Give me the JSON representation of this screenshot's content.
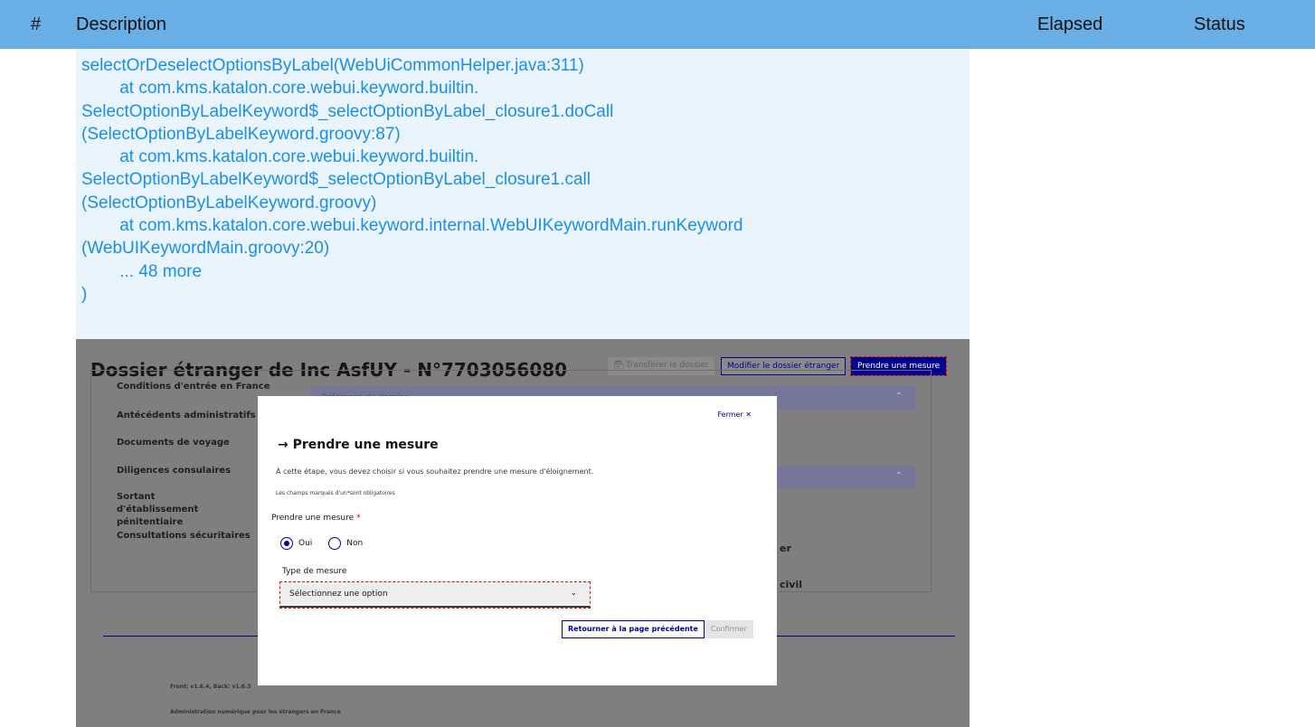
{
  "header": {
    "hash": "#",
    "description": "Description",
    "elapsed": "Elapsed",
    "status": "Status"
  },
  "log_lines": [
    "selectOrDeselectOptionsByLabel(WebUiCommonHelper.java:311)",
    "\tat com.kms.katalon.core.webui.keyword.builtin.",
    "SelectOptionByLabelKeyword$_selectOptionByLabel_closure1.doCall",
    "(SelectOptionByLabelKeyword.groovy:87)",
    "\tat com.kms.katalon.core.webui.keyword.builtin.",
    "SelectOptionByLabelKeyword$_selectOptionByLabel_closure1.call",
    "(SelectOptionByLabelKeyword.groovy)",
    "\tat com.kms.katalon.core.webui.keyword.internal.WebUIKeywordMain.runKeyword",
    "(WebUIKeywordMain.groovy:20)",
    "\t... 48 more",
    ")"
  ],
  "screenshot": {
    "page_title": "Dossier étranger de Inc AsfUY - N°7703056080",
    "toolbar": {
      "transfer": "Transférer le dossier",
      "modify": "Modifier le dossier étranger",
      "take_measure": "Prendre une mesure"
    },
    "sidenav": [
      "Conditions d'entrée en France",
      "Antécédents administratifs",
      "Documents de voyage",
      "Diligences consulaires",
      "Sortant d'établissement pénitentiaire",
      "Consultations sécuritaires"
    ],
    "section_ref": "Référence du dossier",
    "partial_right": [
      "er",
      "civil"
    ],
    "footer_version": "Front: v1.6.4, Back: v1.6.3",
    "footer_tagline": "Administration numérique pour les étrangers en France",
    "modal": {
      "close": "Fermer",
      "title": "Prendre une mesure",
      "description": "À cette étape, vous devez choisir si vous souhaitez prendre une mesure d'éloignement.",
      "required_note_pre": "Les champs marqués d'un",
      "required_note_post": "sont obligatoires",
      "field_label": "Prendre une mesure",
      "option_yes": "Oui",
      "option_no": "Non",
      "type_label": "Type de mesure",
      "select_placeholder": "Sélectionnez une option",
      "back_button": "Retourner à la page précédente",
      "confirm_button": "Confirmer"
    }
  }
}
